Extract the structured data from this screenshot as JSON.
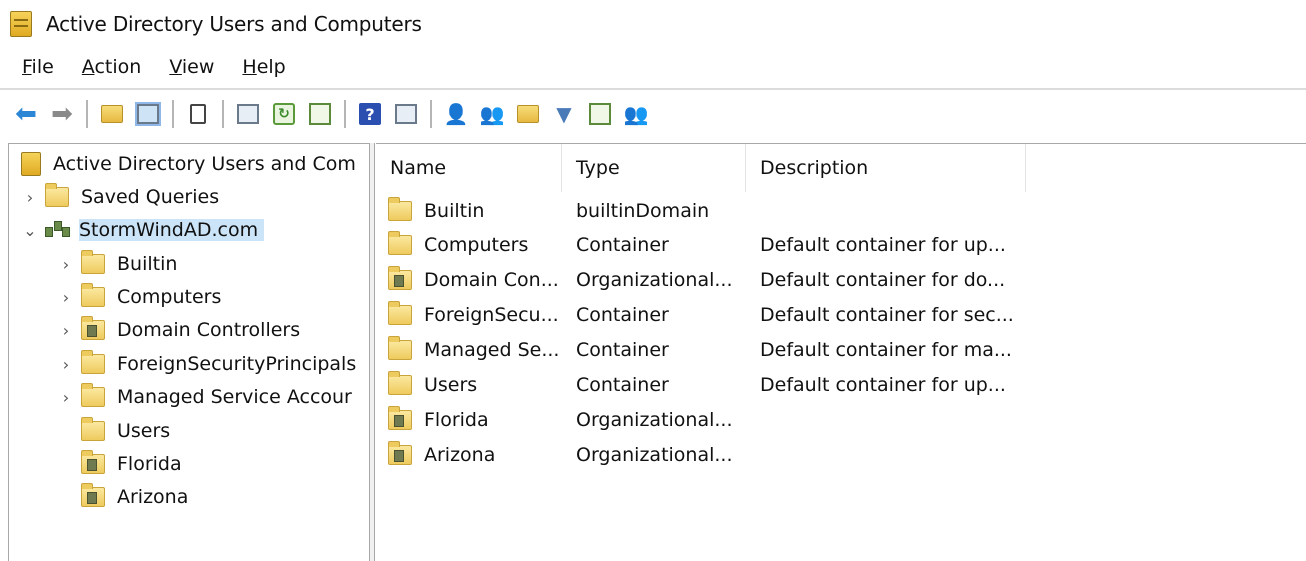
{
  "window": {
    "title": "Active Directory Users and Computers"
  },
  "menu": [
    {
      "label": "File",
      "key": "F",
      "rest": "ile"
    },
    {
      "label": "Action",
      "key": "A",
      "rest": "ction"
    },
    {
      "label": "View",
      "key": "V",
      "rest": "iew"
    },
    {
      "label": "Help",
      "key": "H",
      "rest": "elp"
    }
  ],
  "toolbar_icons": [
    "back-arrow-icon",
    "forward-arrow-icon",
    "up-folder-icon",
    "show-hide-tree-icon",
    "clipboard-icon",
    "properties-icon",
    "refresh-icon",
    "export-list-icon",
    "help-icon",
    "show-pane-icon",
    "new-user-icon",
    "new-group-icon",
    "new-ou-icon",
    "filter-icon",
    "find-icon",
    "add-to-group-icon"
  ],
  "tree": {
    "root": "Active Directory Users and Com",
    "saved_queries": "Saved Queries",
    "domain": "StormWindAD.com",
    "children": [
      {
        "label": "Builtin",
        "type": "folder",
        "expandable": true
      },
      {
        "label": "Computers",
        "type": "folder",
        "expandable": true
      },
      {
        "label": "Domain Controllers",
        "type": "ou",
        "expandable": true
      },
      {
        "label": "ForeignSecurityPrincipals",
        "type": "folder",
        "expandable": true
      },
      {
        "label": "Managed Service Accour",
        "type": "folder",
        "expandable": true
      },
      {
        "label": "Users",
        "type": "folder",
        "expandable": false
      },
      {
        "label": "Florida",
        "type": "ou",
        "expandable": false
      },
      {
        "label": "Arizona",
        "type": "ou",
        "expandable": false
      }
    ]
  },
  "list": {
    "columns": [
      "Name",
      "Type",
      "Description"
    ],
    "rows": [
      {
        "name": "Builtin",
        "type": "builtinDomain",
        "description": "",
        "icon": "folder"
      },
      {
        "name": "Computers",
        "type": "Container",
        "description": "Default container for up...",
        "icon": "folder"
      },
      {
        "name": "Domain Con...",
        "type": "Organizational...",
        "description": "Default container for do...",
        "icon": "ou"
      },
      {
        "name": "ForeignSecu...",
        "type": "Container",
        "description": "Default container for sec...",
        "icon": "folder"
      },
      {
        "name": "Managed Se...",
        "type": "Container",
        "description": "Default container for ma...",
        "icon": "folder"
      },
      {
        "name": "Users",
        "type": "Container",
        "description": "Default container for up...",
        "icon": "folder"
      },
      {
        "name": "Florida",
        "type": "Organizational...",
        "description": "",
        "icon": "ou"
      },
      {
        "name": "Arizona",
        "type": "Organizational...",
        "description": "",
        "icon": "ou"
      }
    ]
  }
}
